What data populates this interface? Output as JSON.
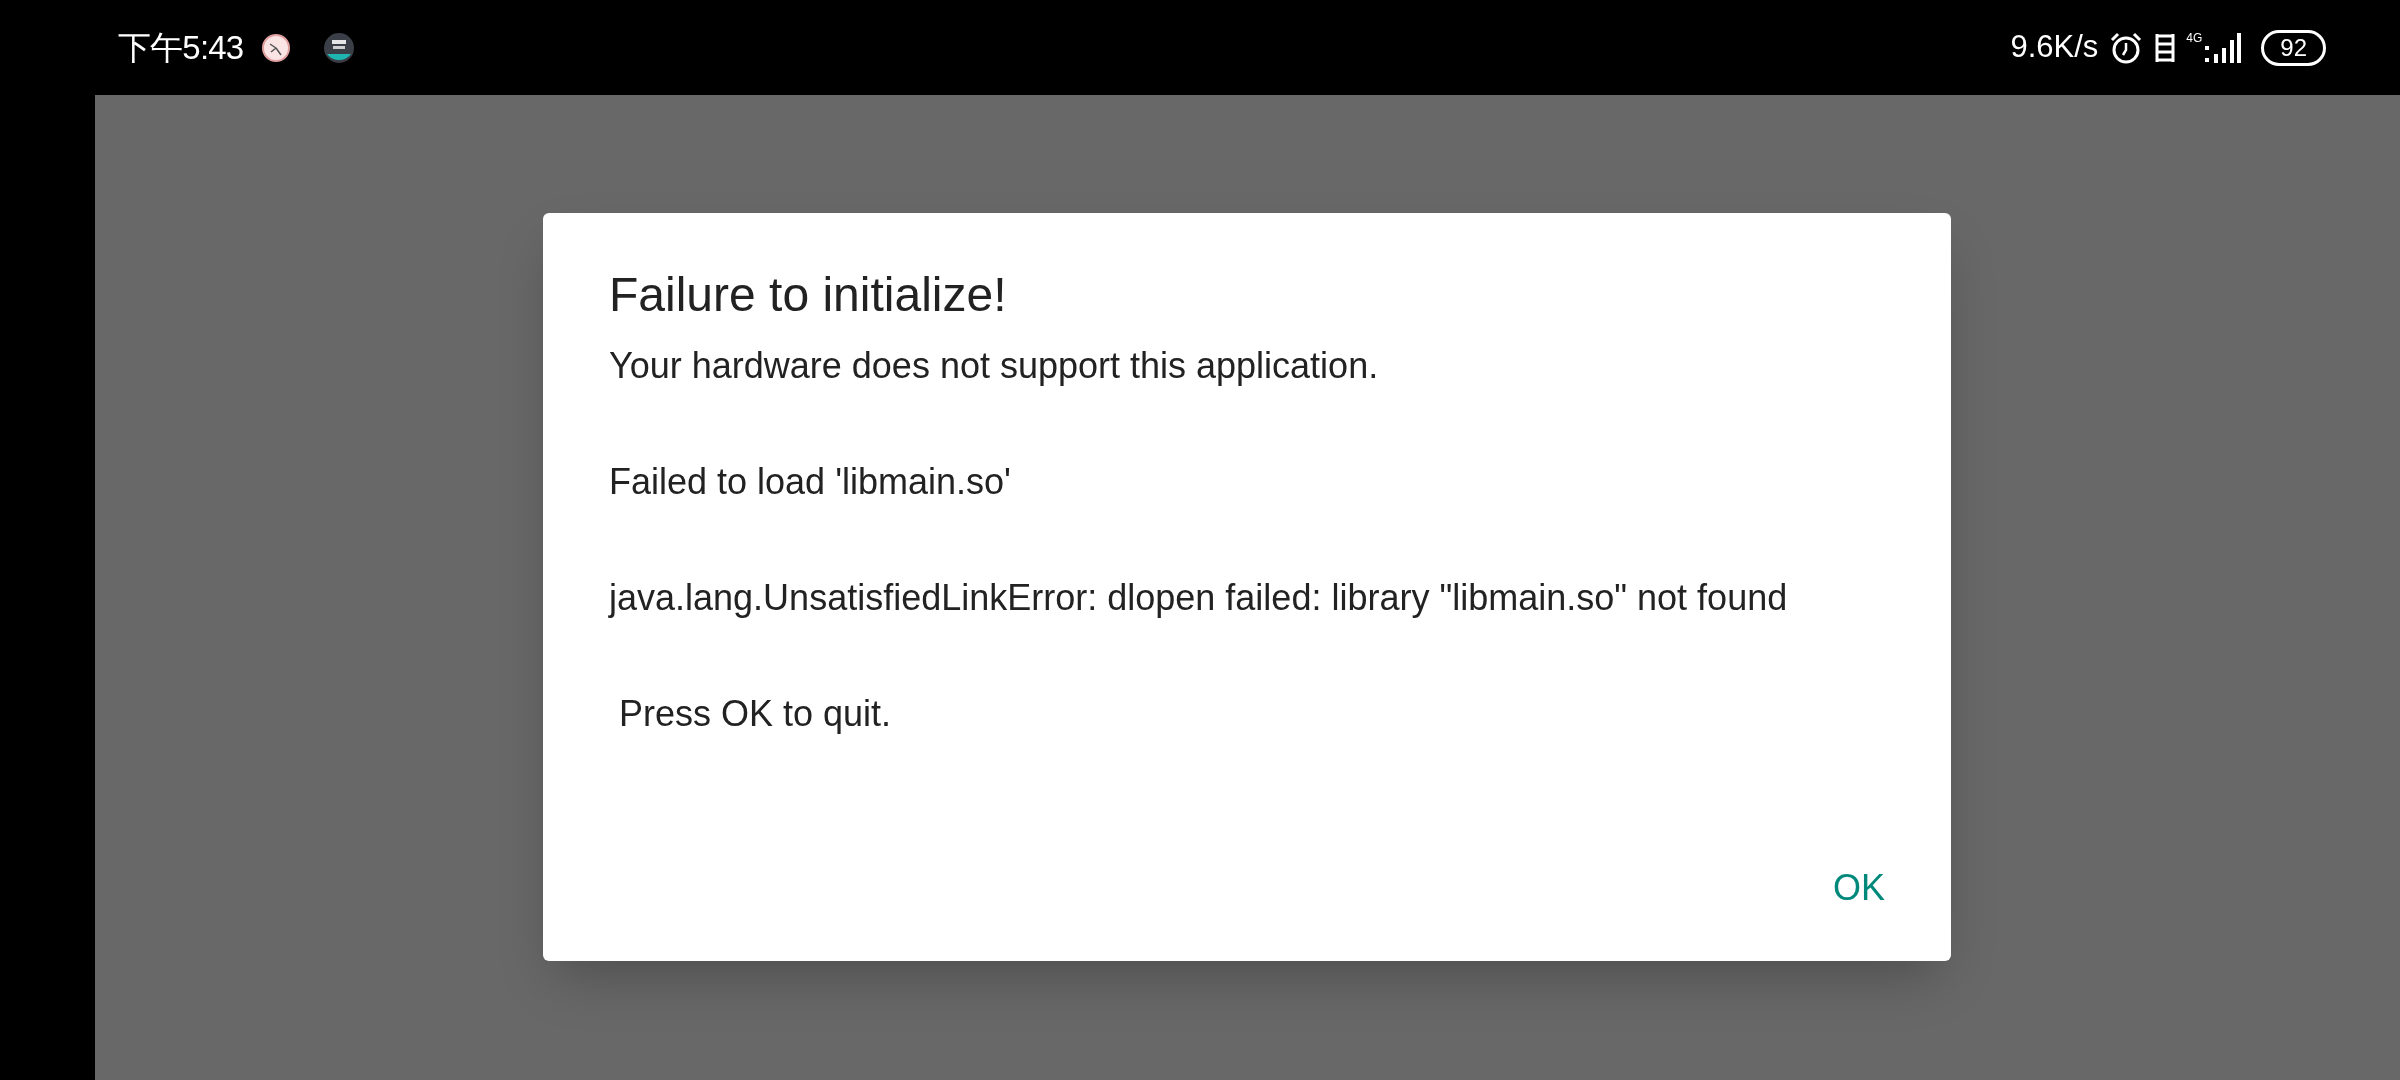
{
  "status_bar": {
    "time": "下午5:43",
    "speed": "9.6K/s",
    "network": "4G",
    "battery": "92"
  },
  "dialog": {
    "title": "Failure to initialize!",
    "paragraphs": [
      "Your hardware does not support this application.",
      "Failed to load 'libmain.so'",
      "java.lang.UnsatisfiedLinkError: dlopen failed: library \"libmain.so\" not found",
      " Press OK to quit."
    ],
    "buttons": [
      "OK"
    ]
  }
}
